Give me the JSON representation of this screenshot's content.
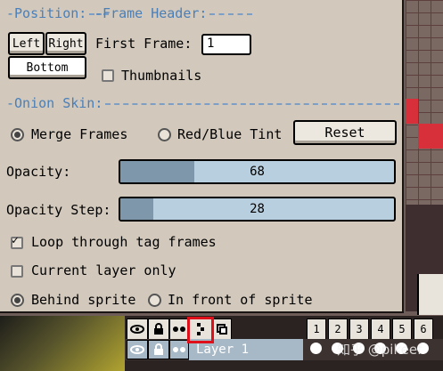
{
  "sections": {
    "position": "-Position:",
    "frame_header": "-Frame Header:",
    "onion_skin": "-Onion Skin:"
  },
  "position": {
    "left_label": "Left",
    "right_label": "Right",
    "bottom_label": "Bottom"
  },
  "frame_header": {
    "first_frame_label": "First Frame:",
    "first_frame_value": "1",
    "thumbnails_label": "Thumbnails",
    "thumbnails_checked": false
  },
  "onion_skin": {
    "merge_frames_label": "Merge Frames",
    "red_blue_tint_label": "Red/Blue Tint",
    "merge_selected": true,
    "reset_label": "Reset",
    "opacity_label": "Opacity:",
    "opacity_value": "68",
    "opacity_fraction": 0.27,
    "opacity_step_label": "Opacity Step:",
    "opacity_step_value": "28",
    "opacity_step_fraction": 0.12,
    "loop_label": "Loop through tag frames",
    "loop_checked": true,
    "current_layer_label": "Current layer only",
    "current_layer_checked": false,
    "behind_label": "Behind sprite",
    "in_front_label": "In front of sprite",
    "behind_selected": true
  },
  "timeline": {
    "frame_numbers": [
      "1",
      "2",
      "3",
      "4",
      "5",
      "6"
    ],
    "layer_name": "Layer 1",
    "eye_icon": "eye-icon",
    "lock_icon": "lock-icon",
    "continuous_icon": "continuous-icon",
    "onion_icon": "onion-skin-icon",
    "watermark": "知乎 @pikeef"
  },
  "colors": {
    "panel_bg": "#d2c9bc",
    "section_accent": "#4a7fb8",
    "slider_track": "#b8cfe0",
    "slider_fill": "#7e97aa",
    "highlight": "#e0101a"
  }
}
